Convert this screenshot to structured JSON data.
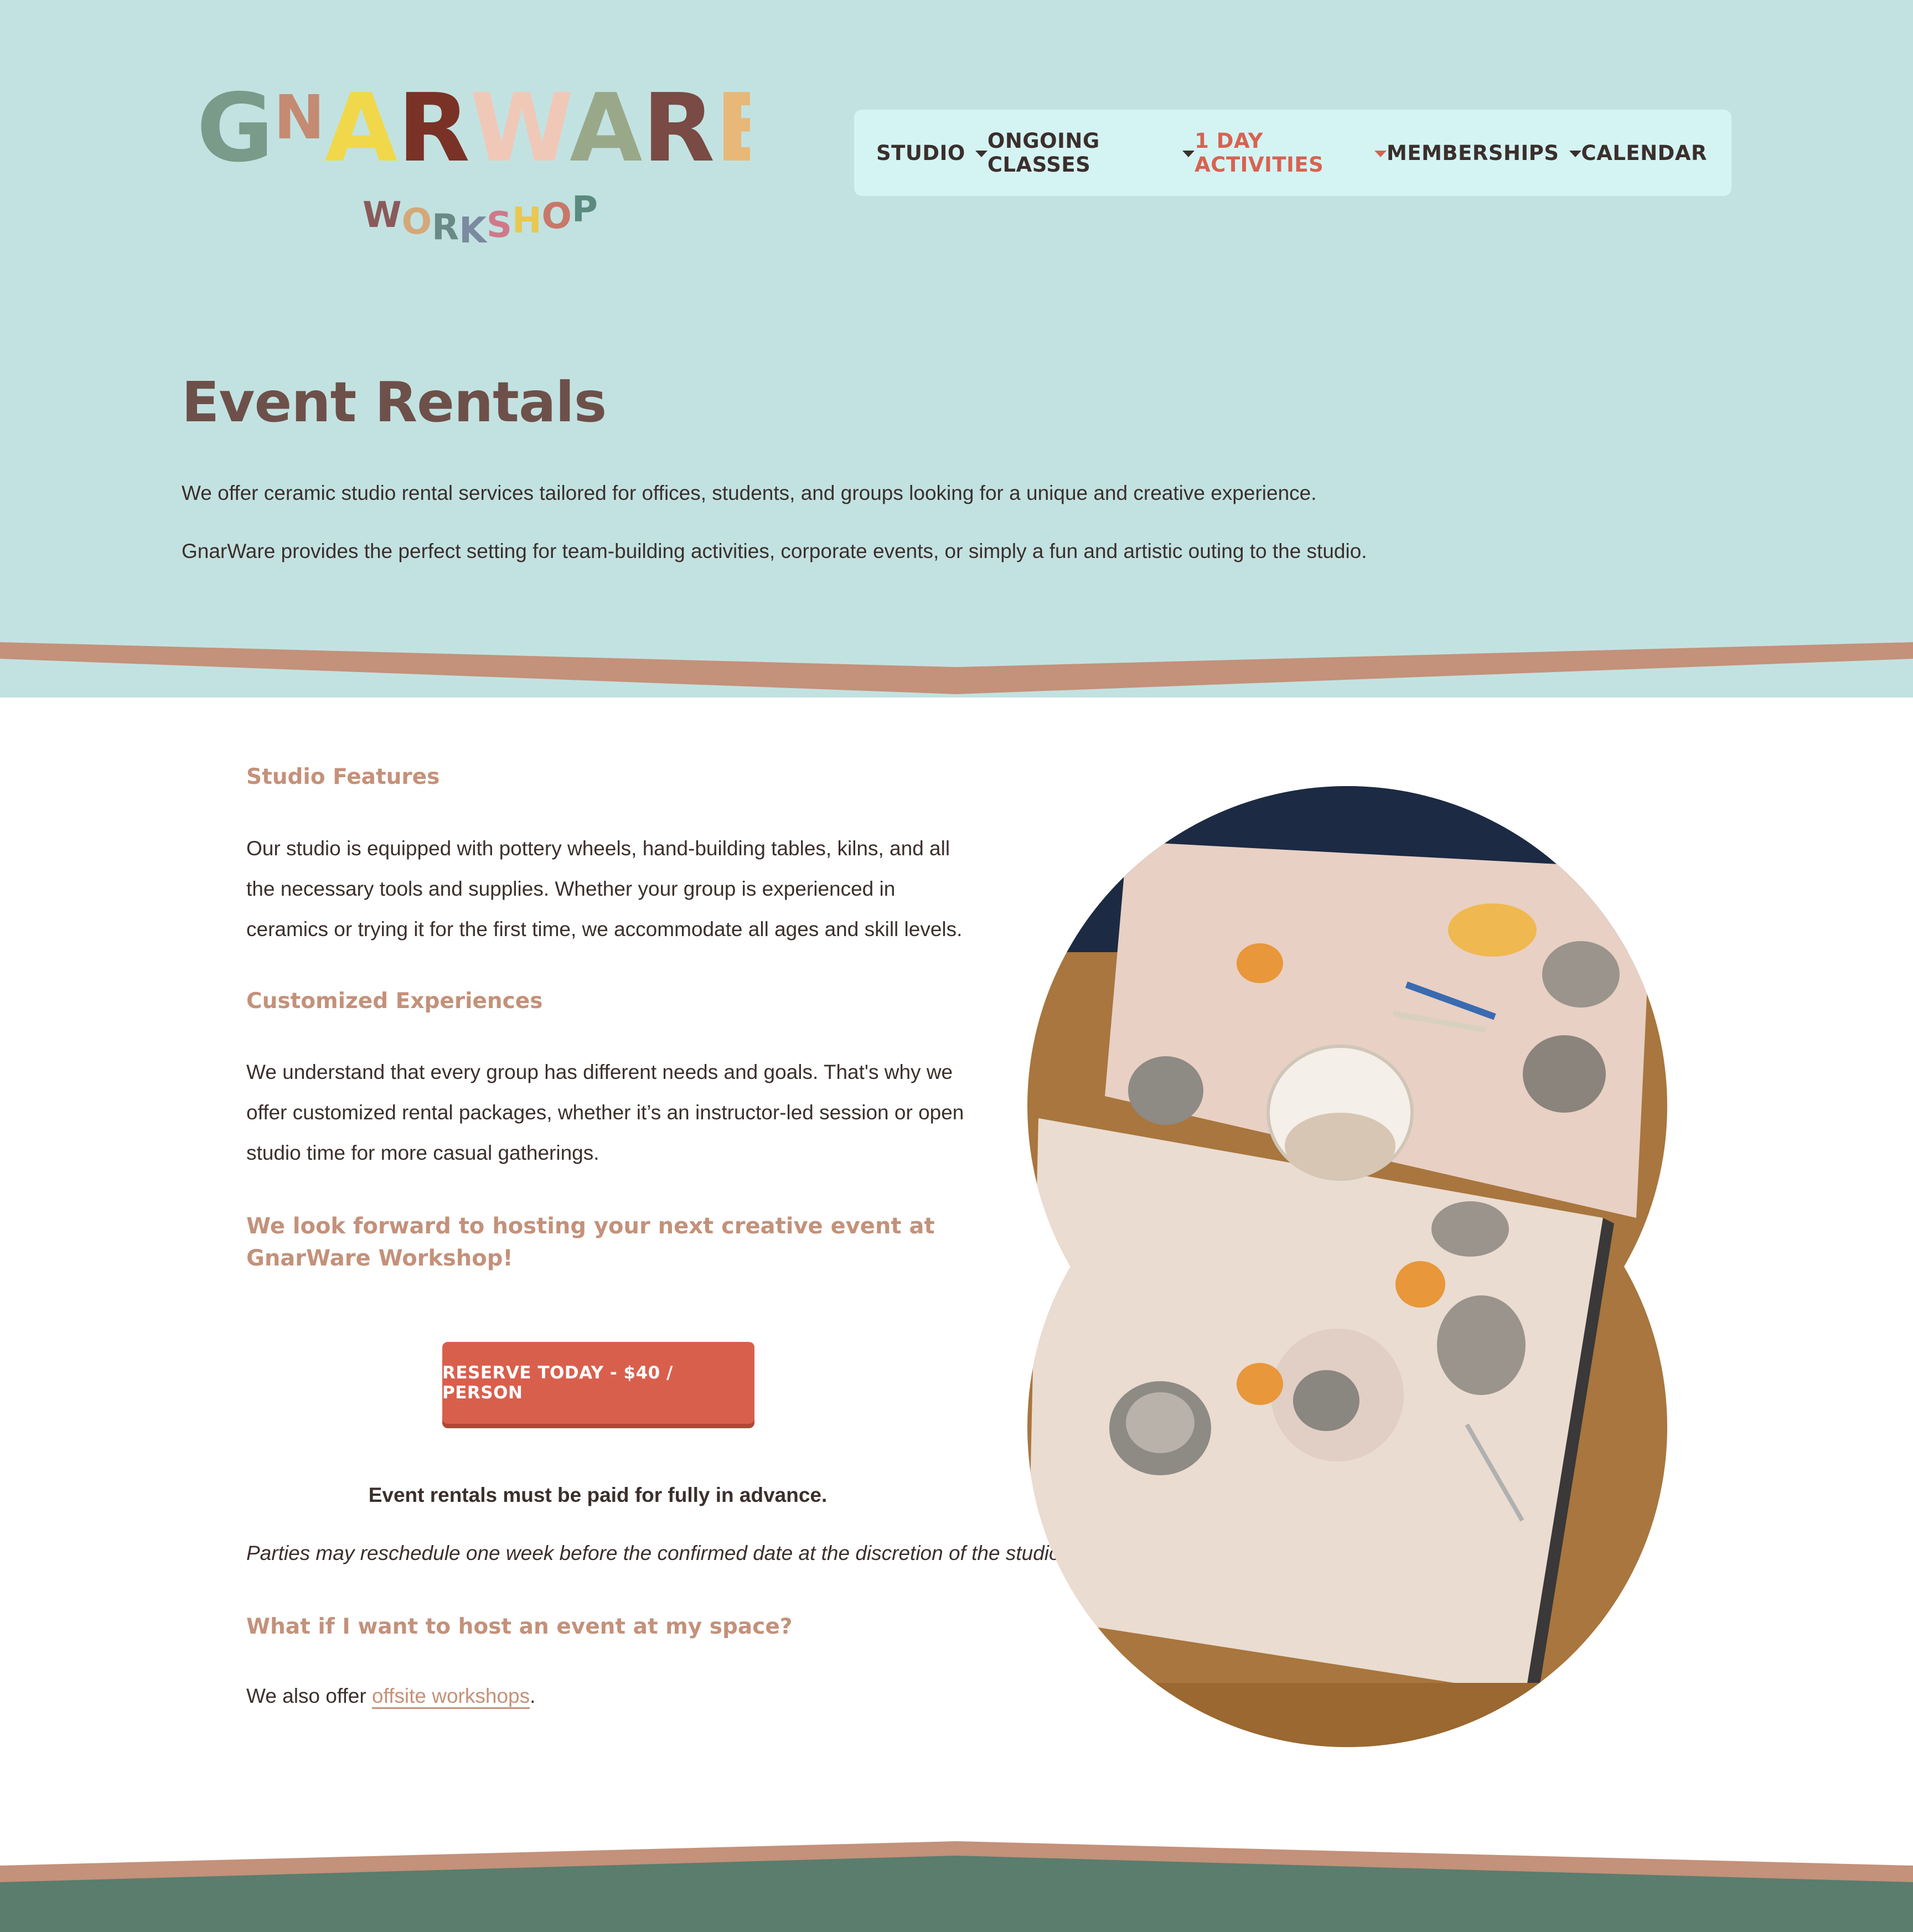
{
  "logo": {
    "wordmark": "GNARWARE",
    "tagline": "WORKSHOP"
  },
  "nav": {
    "items": [
      {
        "label": "STUDIO",
        "dropdown": true,
        "active": false
      },
      {
        "label": "ONGOING CLASSES",
        "dropdown": true,
        "active": false
      },
      {
        "label": "1 DAY ACTIVITIES",
        "dropdown": true,
        "active": true
      },
      {
        "label": "MEMBERSHIPS",
        "dropdown": true,
        "active": false
      },
      {
        "label": "CALENDAR",
        "dropdown": false,
        "active": false
      }
    ]
  },
  "hero": {
    "title": "Event Rentals",
    "intro_1": "We offer ceramic studio rental services tailored for offices, students, and groups looking for a unique and creative experience.",
    "intro_2": "GnarWare provides the perfect setting for team-building activities, corporate events, or simply a fun and artistic outing to the studio."
  },
  "content": {
    "features_heading": "Studio Features",
    "features_text": "Our studio is equipped with pottery wheels, hand-building tables, kilns, and all the necessary tools and supplies. Whether your group is experienced in ceramics or trying it for the first time, we accommodate all ages and skill levels.",
    "custom_heading": "Customized Experiences",
    "custom_text": "We understand that every group has different needs and goals. That's why we offer customized rental packages, whether it’s an instructor-led session or open studio time for more casual gatherings.",
    "closing_heading": "We look forward to hosting your next creative event at GnarWare Workshop!",
    "reserve_button": "RESERVE TODAY - $40 / PERSON",
    "payment_note": "Event rentals must be paid for fully in advance.",
    "reschedule_note": "Parties may reschedule one week before the confirmed date at the discretion of the studio.",
    "offsite_heading": "What if I want to host an event at my space?",
    "offsite_prefix": "We also offer ",
    "offsite_link": "offsite workshops",
    "offsite_suffix": "."
  },
  "colors": {
    "hero_bg": "#c2e2e1",
    "nav_bg": "#d4f4f3",
    "accent_red": "#d95f4d",
    "heading_tan": "#c4917a",
    "title_brown": "#6e504a",
    "divider_tan": "#c4917a",
    "footer_green": "#5a7d6e"
  },
  "image": {
    "description_icon": "photo-pottery-table"
  }
}
